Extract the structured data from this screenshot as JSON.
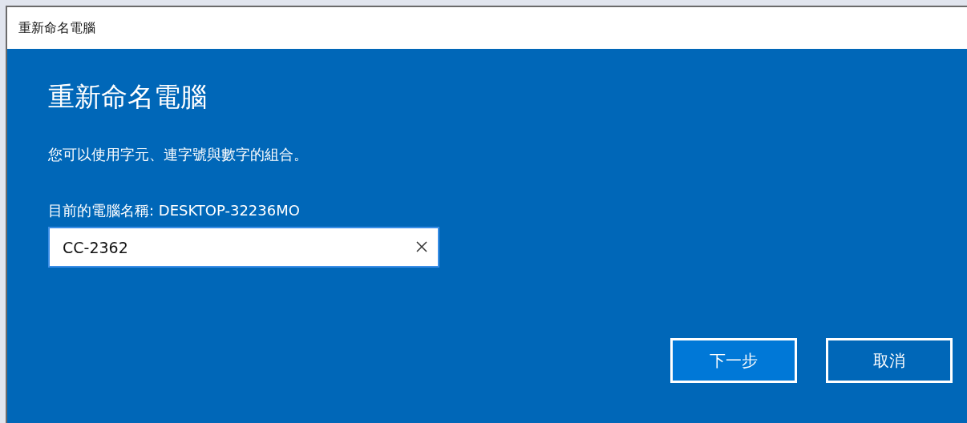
{
  "window": {
    "title": "重新命名電腦"
  },
  "heading": "重新命名電腦",
  "description": "您可以使用字元、連字號與數字的組合。",
  "current_name_label": "目前的電腦名稱: DESKTOP-32236MO",
  "name_field": {
    "value": "CC-2362"
  },
  "buttons": [
    {
      "label": "下一步",
      "default": true
    },
    {
      "label": "取消",
      "default": false
    }
  ]
}
